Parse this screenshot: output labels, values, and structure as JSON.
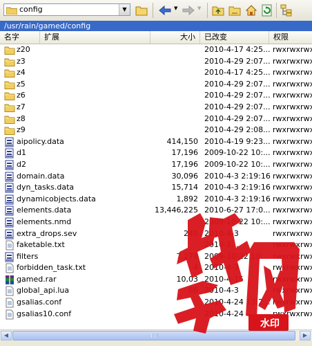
{
  "address": {
    "value": "config"
  },
  "path": "/usr/rain/gamed/config",
  "columns": {
    "name": "名字",
    "ext": "扩展",
    "size": "大小",
    "modified": "已改变",
    "perms": "权限"
  },
  "rows": [
    {
      "type": "folder",
      "name": "z20",
      "size": "",
      "date": "2010-4-17 4:25...",
      "perms": "rwxrwxrwx"
    },
    {
      "type": "folder",
      "name": "z3",
      "size": "",
      "date": "2010-4-29 2:07...",
      "perms": "rwxrwxrwx"
    },
    {
      "type": "folder",
      "name": "z4",
      "size": "",
      "date": "2010-4-17 4:25...",
      "perms": "rwxrwxrwx"
    },
    {
      "type": "folder",
      "name": "z5",
      "size": "",
      "date": "2010-4-29 2:07...",
      "perms": "rwxrwxrwx"
    },
    {
      "type": "folder",
      "name": "z6",
      "size": "",
      "date": "2010-4-29 2:07...",
      "perms": "rwxrwxrwx"
    },
    {
      "type": "folder",
      "name": "z7",
      "size": "",
      "date": "2010-4-29 2:07...",
      "perms": "rwxrwxrwx"
    },
    {
      "type": "folder",
      "name": "z8",
      "size": "",
      "date": "2010-4-29 2:07...",
      "perms": "rwxrwxrwx"
    },
    {
      "type": "folder",
      "name": "z9",
      "size": "",
      "date": "2010-4-29 2:08...",
      "perms": "rwxrwxrwx"
    },
    {
      "type": "data",
      "name": "aipolicy.data",
      "size": "414,150",
      "date": "2010-4-19 9:23...",
      "perms": "rwxrwxrwx"
    },
    {
      "type": "data",
      "name": "d1",
      "size": "17,196",
      "date": "2009-10-22 10:...",
      "perms": "rwxrwxrwx"
    },
    {
      "type": "data",
      "name": "d2",
      "size": "17,196",
      "date": "2009-10-22 10:...",
      "perms": "rwxrwxrwx"
    },
    {
      "type": "data",
      "name": "domain.data",
      "size": "30,096",
      "date": "2010-4-3 2:19:16",
      "perms": "rwxrwxrwx"
    },
    {
      "type": "data",
      "name": "dyn_tasks.data",
      "size": "15,714",
      "date": "2010-4-3 2:19:16",
      "perms": "rwxrwxrwx"
    },
    {
      "type": "data",
      "name": "dynamicobjects.data",
      "size": "1,892",
      "date": "2010-4-3 2:19:16",
      "perms": "rwxrwxrwx"
    },
    {
      "type": "data",
      "name": "elements.data",
      "size": "13,446,225",
      "date": "2010-6-27 17:0...",
      "perms": "rwxrwxrwx"
    },
    {
      "type": "data",
      "name": "elements.nmd",
      "size": "",
      "date": "2009-10-22 10:...",
      "perms": "rwxrwxrwx"
    },
    {
      "type": "data",
      "name": "extra_drops.sev",
      "size": "245",
      "date": "2010-4-3",
      "perms": "rwxrwxrwx"
    },
    {
      "type": "text",
      "name": "faketable.txt",
      "size": "",
      "date": "2010-1...",
      "perms": "rwxrwxrwx"
    },
    {
      "type": "data",
      "name": "filters",
      "size": "7,278",
      "date": "2009-10-22 10:...",
      "perms": "rwxrwxrwx"
    },
    {
      "type": "text",
      "name": "forbidden_task.txt",
      "size": "4",
      "date": "2010-4-3",
      "perms": "rwxrwxrwx"
    },
    {
      "type": "rar",
      "name": "gamed.rar",
      "size": "10,03",
      "date": "2010-4-15",
      "perms": "rwxrwxrwx"
    },
    {
      "type": "text",
      "name": "global_api.lua",
      "size": "86",
      "date": "2010-4-3",
      "perms": "rwxrwxrwx"
    },
    {
      "type": "text",
      "name": "gsalias.conf",
      "size": "",
      "date": "2010-4-24 13:2...",
      "perms": "rwxrwxrwx"
    },
    {
      "type": "text",
      "name": "gsalias10.conf",
      "size": "",
      "date": "2010-4-24",
      "perms": "rwxrwxrwx"
    }
  ],
  "watermark": {
    "badge": "水印"
  },
  "icons": {
    "folder": "folder-icon",
    "data": "data-file-icon",
    "text": "text-file-icon",
    "rar": "rar-archive-icon"
  }
}
